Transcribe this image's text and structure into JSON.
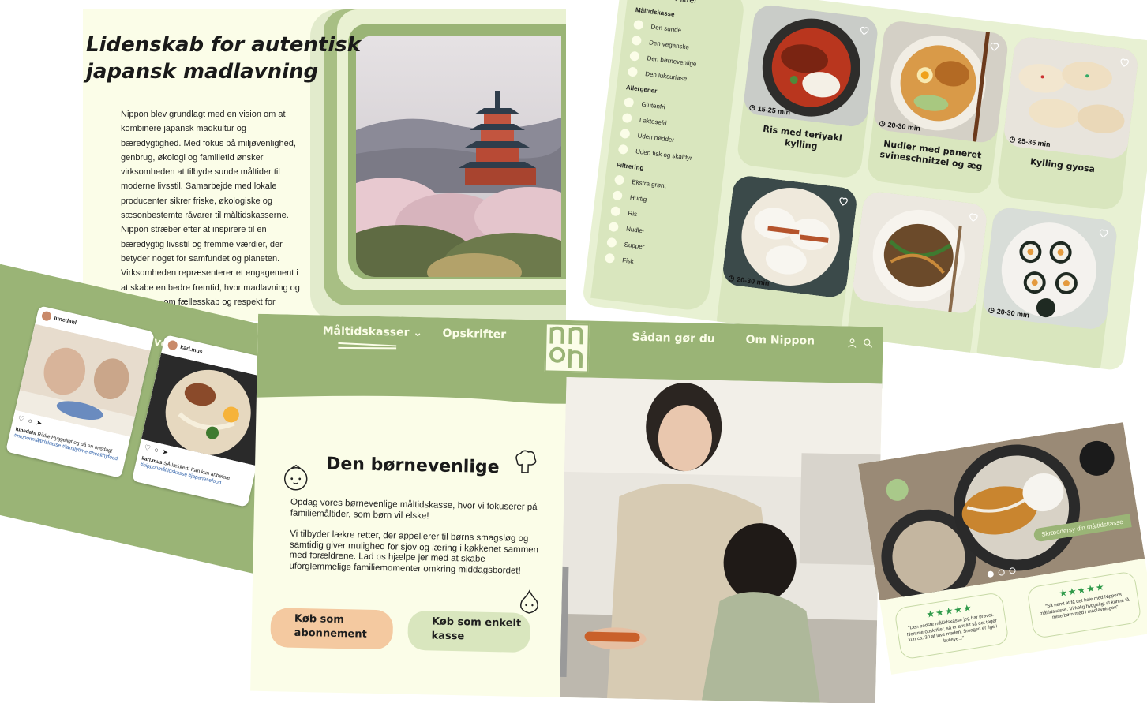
{
  "about": {
    "title": "Lidenskab for autentisk japansk madlavning",
    "body": "Nippon blev grundlagt med en vision om at kombinere japansk madkultur og bæredygtighed. Med fokus på miljøvenlighed, genbrug, økologi og familietid ønsker virksomheden at tilbyde sunde måltider til moderne livsstil. Samarbejde med lokale producenter sikrer friske, økologiske og sæsonbestemte råvarer til måltidskasserne. Nippon stræber efter at inspirere til en bæredygtig livsstil og fremme værdier, der betyder noget for samfundet og planeten. Virksomheden repræsenterer et engagement i at skabe en bedre fremtid, hvor madlavning og måltider ... om fællesskab og respekt for",
    "image": "pagoda-with-cherry-blossoms"
  },
  "recipes": {
    "filter_title": "Filtrér",
    "groups": [
      {
        "heading": "Måltidskasse",
        "options": [
          "Den sunde",
          "Den veganske",
          "Den børnevenlige",
          "Den luksuriøse"
        ]
      },
      {
        "heading": "Allergener",
        "options": [
          "Glutenfri",
          "Laktosefri",
          "Uden nødder",
          "Uden fisk og skaldyr"
        ]
      },
      {
        "heading": "Filtrering",
        "options": [
          "Ekstra grønt",
          "Hurtig",
          "Ris",
          "Nudler",
          "Supper",
          "Fisk"
        ]
      }
    ],
    "cards": [
      {
        "name": "Ris med teriyaki kylling",
        "time": "15-25 min"
      },
      {
        "name": "Nudler med paneret svineschnitzel og æg",
        "time": "20-30 min"
      },
      {
        "name": "Kylling gyosa",
        "time": "25-35 min"
      },
      {
        "name": "",
        "time": "20-30 min"
      },
      {
        "name": "",
        "time": ""
      },
      {
        "name": "",
        "time": "20-30 min"
      }
    ],
    "colors": {
      "panel": "#e8f1d3",
      "card": "#d9e6be"
    }
  },
  "instagram": {
    "title": "Hverdagen med Nippon",
    "posts": [
      {
        "user": "lunedahl",
        "caption": "Rikke Hyggeligt og på en onsdag!",
        "caption_user": "lunedahl",
        "tags": "#nipponmåltidskasse #familytime #healthyfood"
      },
      {
        "user": "karl.mus",
        "caption": "SÅ lækkert! Kan kun anbefale",
        "caption_user": "karl.mus",
        "tags": "#nipponmåltidskasse #japanesefood"
      }
    ]
  },
  "hero": {
    "nav": {
      "boxes": "Måltidskasser",
      "recipes": "Opskrifter",
      "how": "Sådan gør du",
      "about": "Om Nippon"
    },
    "title": "Den børnevenlige",
    "p1": "Opdag vores børnevenlige måltidskasse, hvor vi fokuserer på familiemåltider, som børn vil elske!",
    "p2": "Vi tilbyder lækre retter, der appellerer til børns smagsløg og samtidig giver mulighed for sjov og læring i køkkenet sammen med forældrene. Lad os hjælpe jer med at skabe uforglemmelige familiemomenter omkring middagsbordet!",
    "buttons": {
      "subscription": "Køb som abonnement",
      "single": "Køb som enkelt kasse"
    },
    "colors": {
      "brand": "#9ab476",
      "cream": "#fbfde8",
      "peach": "#f4c9a0"
    }
  },
  "reviews": {
    "tag": "Skræddersy din måltidskasse",
    "items": [
      {
        "stars": "★★★★★",
        "text": "\"Den bedste måltidskasse jeg har prøvet. Nemme opskrifter, så er afmålt så det tager kun ca. 30 at lave maden. Smagen er lige i bulleye...\""
      },
      {
        "stars": "★★★★★",
        "text": "\"Så nemt at få det hele med Nippons måltidskasse. Virkelig hyggeligt at kunne få mine børn med i madlavningen\""
      }
    ]
  }
}
